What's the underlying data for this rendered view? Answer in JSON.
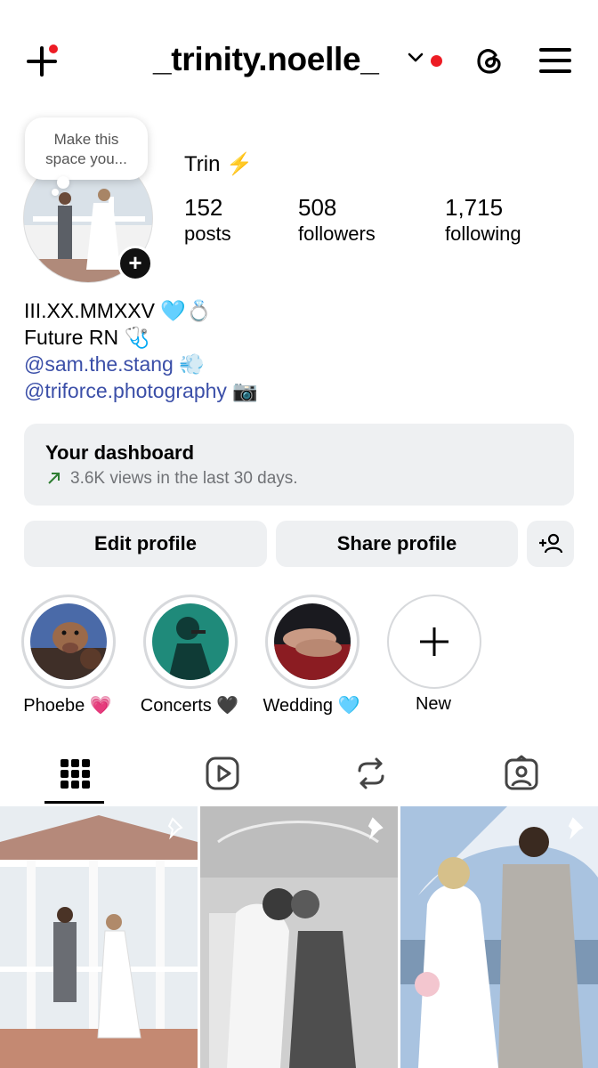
{
  "header": {
    "username": "_trinity.noelle_",
    "icons": [
      "new-post-icon",
      "chevron-down-icon",
      "threads-icon",
      "menu-icon"
    ]
  },
  "profile": {
    "bubble_text_line1": "Make this",
    "bubble_text_line2": "space you...",
    "display_name": "Trin ⚡",
    "stats": {
      "posts_count": "152",
      "posts_label": "posts",
      "followers_count": "508",
      "followers_label": "followers",
      "following_count": "1,715",
      "following_label": "following"
    },
    "bio": {
      "line1": "III.XX.MMXXV 🩵💍",
      "line2": "Future RN 🩺",
      "link1": "@sam.the.stang",
      "link1_emoji": "💨",
      "link2": "@triforce.photography",
      "link2_emoji": "📷"
    }
  },
  "dashboard": {
    "title": "Your dashboard",
    "subtitle": "3.6K views in the last 30 days."
  },
  "buttons": {
    "edit": "Edit profile",
    "share": "Share profile"
  },
  "highlights": [
    {
      "label": "Phoebe 💗"
    },
    {
      "label": "Concerts 🖤"
    },
    {
      "label": "Wedding 🩵"
    },
    {
      "label": "New"
    }
  ],
  "tabs": [
    "grid-icon",
    "reels-icon",
    "reposts-icon",
    "tagged-icon"
  ],
  "colors": {
    "accent_red": "#ed1c24",
    "link_blue": "#3b4fa8",
    "panel_gray": "#eef0f2",
    "trend_green": "#2e7d32"
  }
}
